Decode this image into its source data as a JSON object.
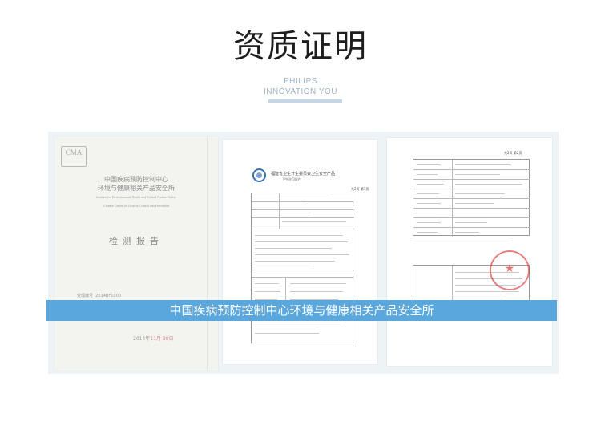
{
  "header": {
    "title": "资质证明",
    "subtitle_line1": "PHILIPS",
    "subtitle_line2": "INNOVATION YOU"
  },
  "doc1": {
    "cma_logo": "CMA",
    "org_cn_line1": "中国疾病预防控制中心",
    "org_cn_line2": "环境与健康相关产品安全所",
    "org_en_line1": "Institute for Environmental Health and Related Product Safety",
    "org_en_line2": "Chinese Center for Disease Control and Prevention",
    "report_title": "检测报告",
    "report_no_label": "受理编号",
    "report_no": "2014BF1000",
    "date_prefix": "2014年",
    "date_rest": "11月 30日"
  },
  "doc2": {
    "header_line1": "福建省卫生计生委员会卫生安全产品",
    "header_line2": "卫生许可批件",
    "page_label": "共2页 第1页"
  },
  "doc3": {
    "page_label": "共2页 第2页"
  },
  "banner": {
    "text": "中国疾病预防控制中心环境与健康相关产品安全所"
  },
  "colors": {
    "banner": "#5aa7de",
    "panel": "#eef3f6",
    "subtitle": "#9fb5c8",
    "stamp": "#dc3c3c"
  }
}
